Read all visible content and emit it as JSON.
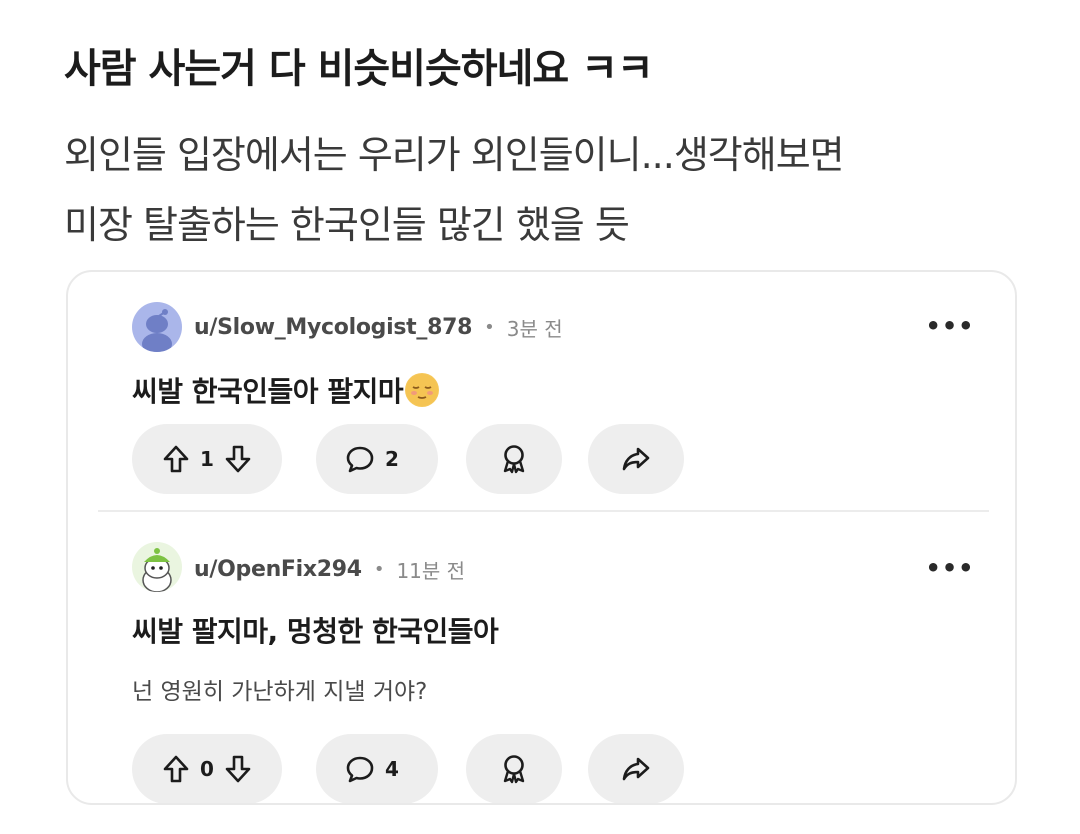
{
  "post": {
    "title": "사람 사는거 다 비슷비슷하네요 ㅋㅋ",
    "body_lines": [
      "외인들 입장에서는 우리가 외인들이니...생각해보면",
      "미장 탈출하는 한국인들 많긴 했을 듯"
    ]
  },
  "comments": [
    {
      "username": "u/Slow_Mycologist_878",
      "separator": "•",
      "time": "3분 전",
      "more": "•••",
      "text": "씨발 한국인들아 팔지마",
      "emoji": "relieved-face-emoji",
      "subtext": "",
      "upvotes": "1",
      "replies": "2",
      "avatar_color": "#aab6ea"
    },
    {
      "username": "u/OpenFix294",
      "separator": "•",
      "time": "11분 전",
      "more": "•••",
      "text": "씨발 팔지마, 멍청한 한국인들아",
      "subtext": "넌 영원히 가난하게 지낼 거야?",
      "upvotes": "0",
      "replies": "4",
      "avatar_color": "#7dc243"
    }
  ],
  "colors": {
    "pill_background": "#eeeeee",
    "card_border": "#e9e9e9",
    "meta_text": "#8a8a8a"
  },
  "icons": [
    "upvote-icon",
    "downvote-icon",
    "reply-icon",
    "award-icon",
    "share-icon"
  ]
}
